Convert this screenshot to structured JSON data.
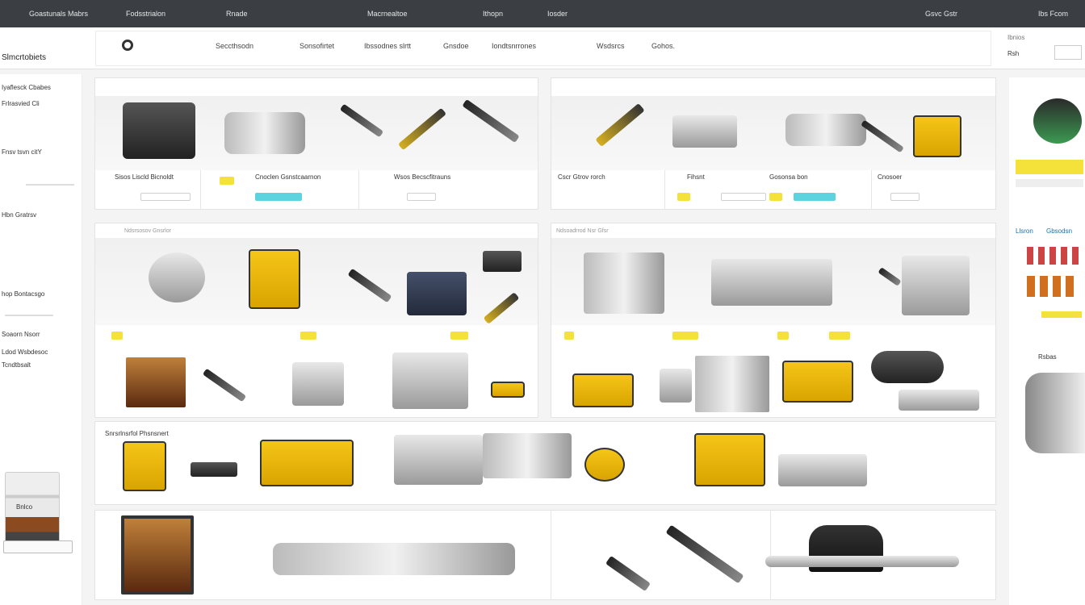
{
  "topbar": {
    "brand": "Goastunals Mabrs",
    "nav_1": "Fodsstrialon",
    "nav_2": "Rnade",
    "nav_3": "Macrnealtoe",
    "nav_4": "Ithopn",
    "nav_5": "Iosder",
    "right_1": "Gsvc Gstr",
    "right_2": "Ibs Fcom"
  },
  "header": {
    "site_name": "Slmcrtobiets",
    "section_1": "Seccthsodn",
    "section_2": "Sonsofirtet",
    "section_3": "Ibssodnes slrtt",
    "section_4": "Gnsdoe",
    "section_5": "Iondtsnrrones",
    "section_6": "Wsdsrcs",
    "section_7": "Gohos.",
    "account_1": "Ibnios",
    "account_2": "Rsh"
  },
  "sidebar": {
    "items": [
      "Iyaflesck Cbabes",
      "Frlrasvied Cli",
      "Fnsv tsvn citY",
      "Hbn Gratrsv",
      "hop Bontacsgo",
      "Soaorn Nsorr",
      "Ldod Wsbdesoc",
      "Tcndtbsalt",
      "Bnlco"
    ]
  },
  "rsidebar": {
    "link_1": "Llsron",
    "link_2": "Gbsodsn",
    "text_1": "Rsbas"
  },
  "panels": {
    "p1": {
      "labels": [
        "Sisos Liscld Bicnoldt",
        "Cnoclen Gsnstcaarnon",
        "Wsos Becscfitrauns"
      ]
    },
    "p2": {
      "labels": [
        "Cscr Gtrov rorch",
        "Fihsnt",
        "Gosonsa bon",
        "Cnosoer"
      ]
    },
    "p3": {
      "title": "Ndsrsosov Gnsrlor"
    },
    "p4": {
      "title": "Ndsoadrrod Nsr Gfsr"
    },
    "p5": {
      "title": "Snrsrlnsrfol Phsnsnert"
    }
  },
  "colors": {
    "accent": "#f4e13a",
    "accent_2": "#5ed3e0",
    "topbar": "#3b3f44"
  }
}
